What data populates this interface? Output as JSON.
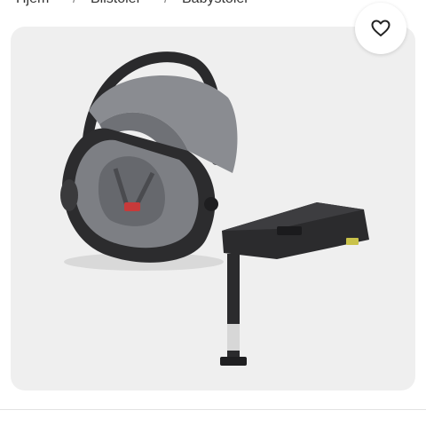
{
  "breadcrumb": {
    "items": [
      {
        "label": "Hjem"
      },
      {
        "label": "Bilstoler"
      },
      {
        "label": "Babystoler"
      }
    ],
    "separator": "/"
  },
  "product": {
    "image_icon": "infant-car-seat-with-isofix-base",
    "favorite_icon": "heart-outline-icon"
  },
  "colors": {
    "card_bg": "#efefef",
    "seat_fabric": "#7d7f84",
    "shell_dark": "#2b2b2d"
  }
}
